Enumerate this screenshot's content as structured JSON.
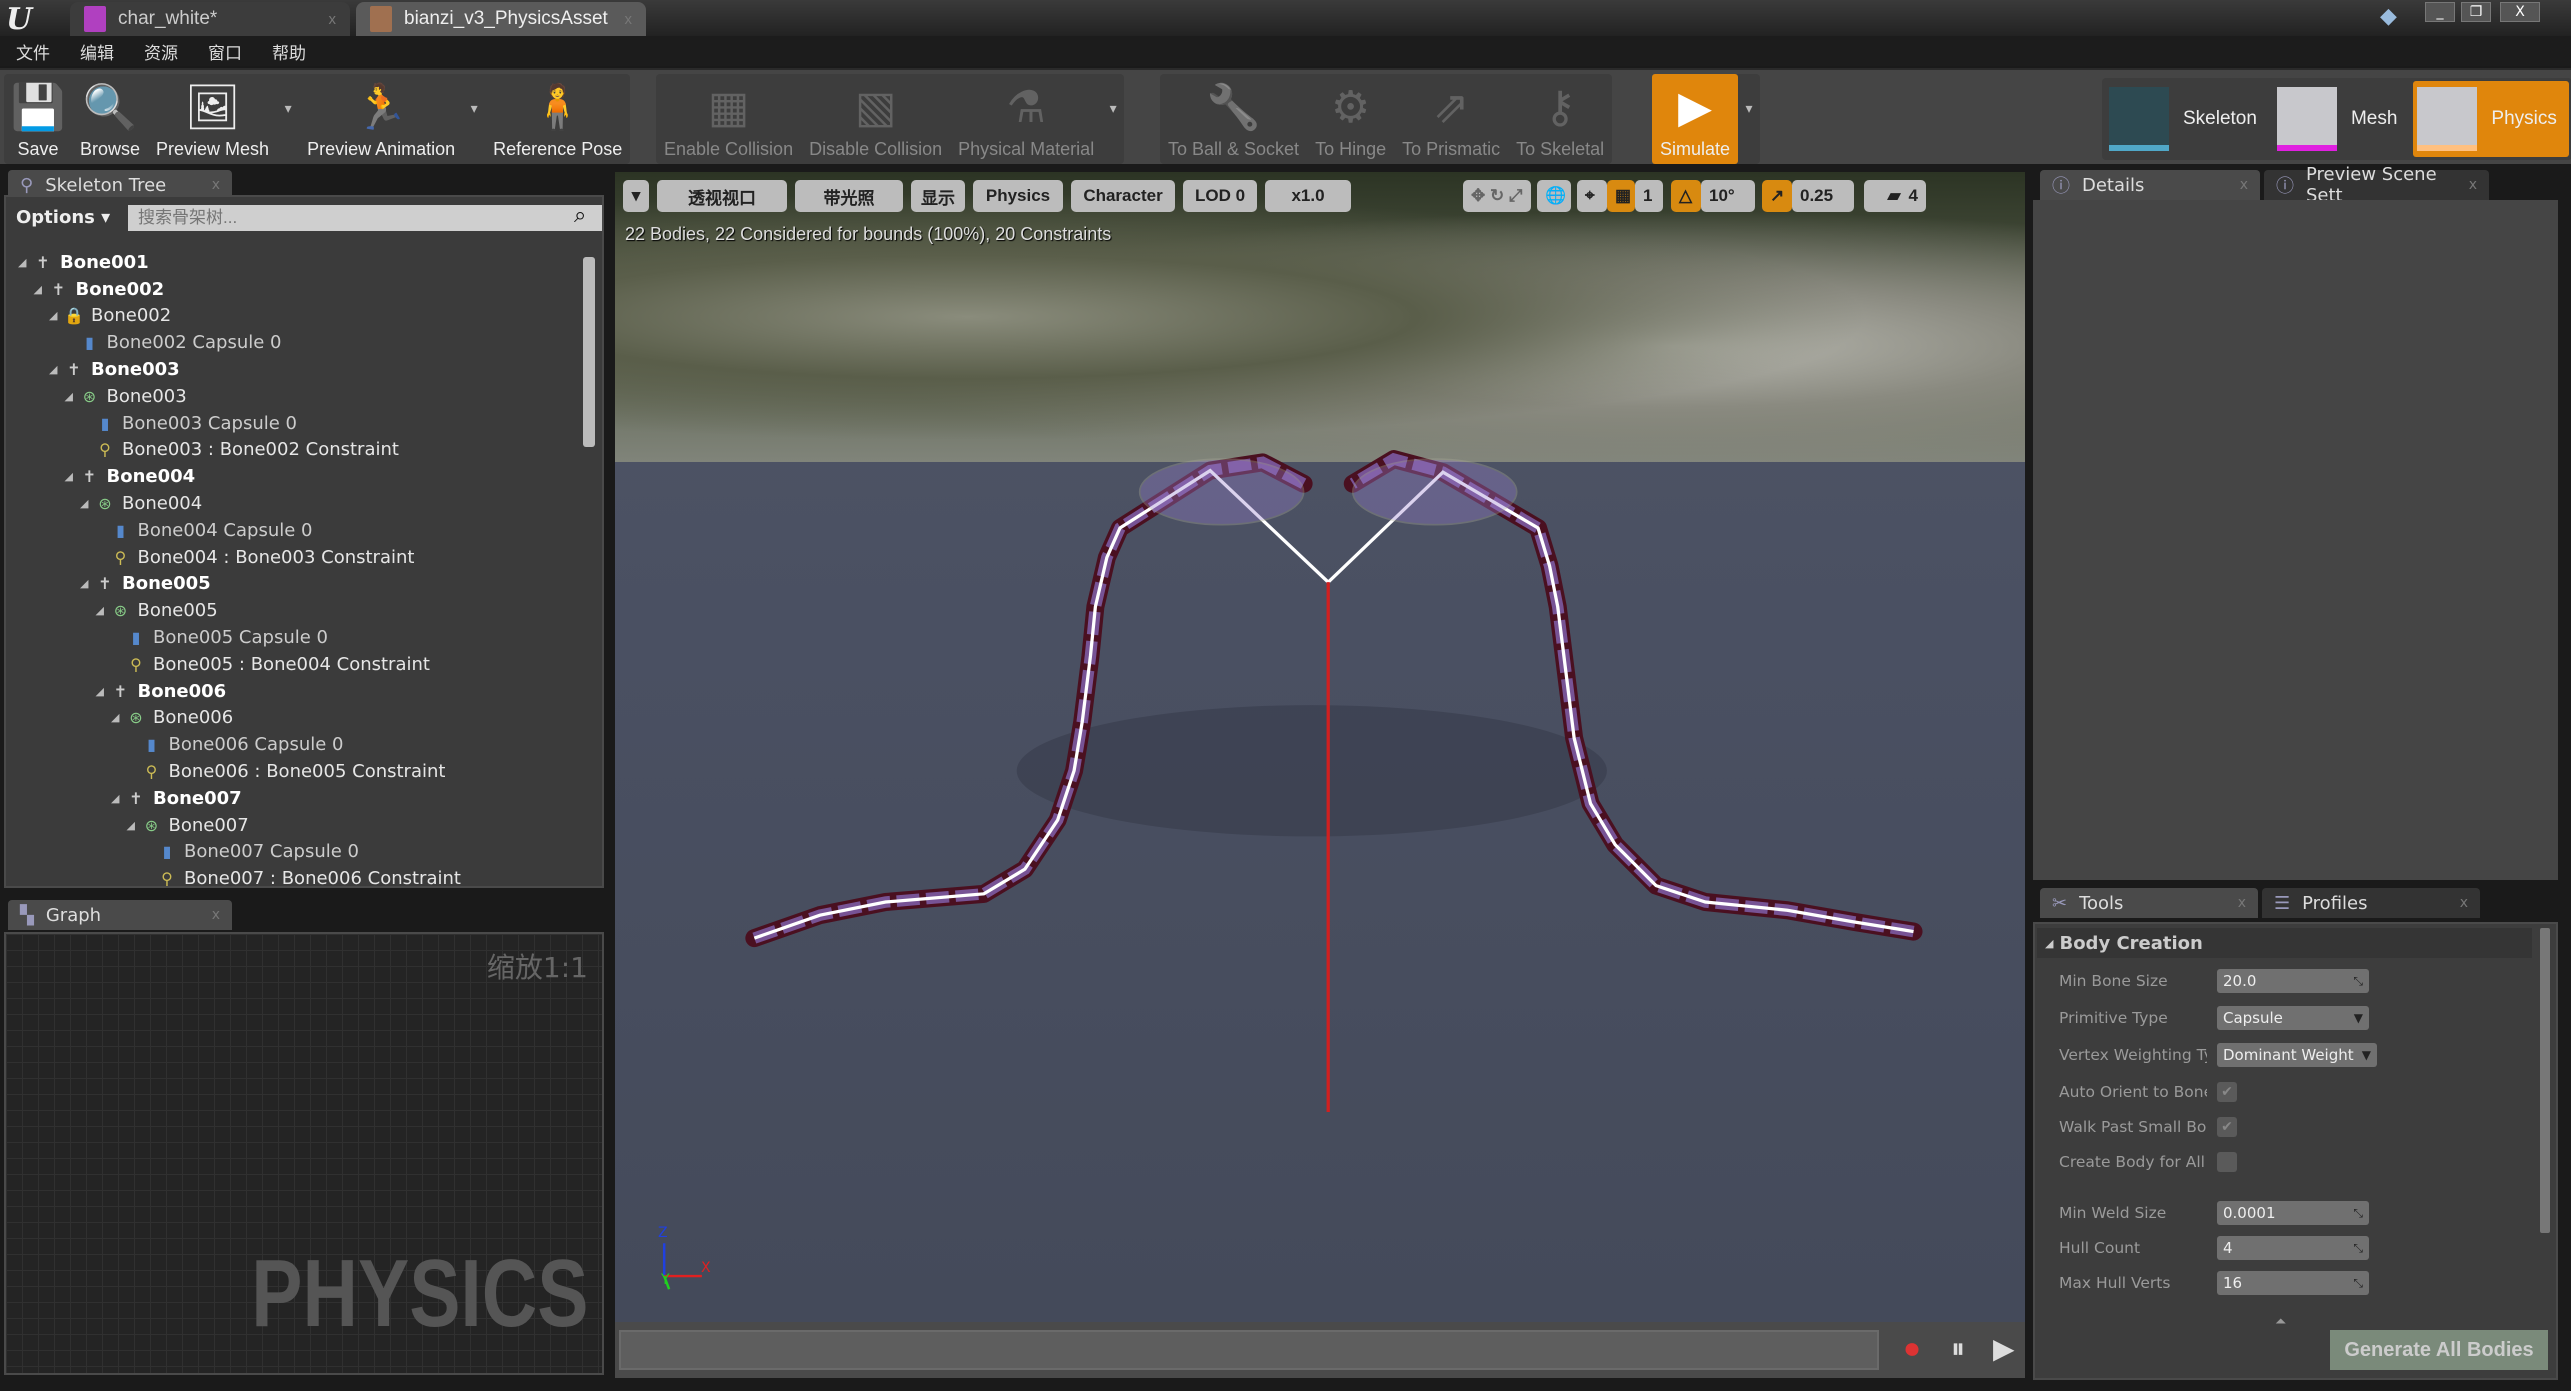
{
  "titlebar": {
    "tabs": [
      {
        "label": "char_white*",
        "color": "#b040c0"
      },
      {
        "label": "bianzi_v3_PhysicsAsset",
        "color": "#a07050"
      }
    ],
    "close": "x",
    "win": [
      "_",
      "❐",
      "X"
    ]
  },
  "menu": [
    "文件",
    "编辑",
    "资源",
    "窗口",
    "帮助"
  ],
  "toolbar": {
    "main": [
      {
        "label": "Save",
        "icon": "💾",
        "name": "save"
      },
      {
        "label": "Browse",
        "icon": "🔍",
        "name": "browse"
      },
      {
        "label": "Preview Mesh",
        "icon": "🖼",
        "name": "preview-mesh",
        "drop": true
      },
      {
        "label": "Preview Animation",
        "icon": "🏃",
        "name": "preview-animation",
        "drop": true
      },
      {
        "label": "Reference Pose",
        "icon": "🧍",
        "name": "reference-pose"
      }
    ],
    "collision": [
      {
        "label": "Enable Collision",
        "icon": "▦",
        "name": "enable-collision"
      },
      {
        "label": "Disable Collision",
        "icon": "▧",
        "name": "disable-collision"
      },
      {
        "label": "Physical Material",
        "icon": "⚗",
        "name": "physical-material",
        "drop": true
      }
    ],
    "constraints": [
      {
        "label": "To Ball & Socket",
        "icon": "🔧",
        "name": "to-ball-socket"
      },
      {
        "label": "To Hinge",
        "icon": "⚙",
        "name": "to-hinge"
      },
      {
        "label": "To Prismatic",
        "icon": "⇗",
        "name": "to-prismatic"
      },
      {
        "label": "To Skeletal",
        "icon": "⚷",
        "name": "to-skeletal"
      }
    ],
    "simulate": {
      "label": "Simulate",
      "icon": "▶"
    },
    "drop": "▾",
    "modes": [
      {
        "label": "Skeleton",
        "bar": "#50a8c8"
      },
      {
        "label": "Mesh",
        "bar": "#e020e0"
      },
      {
        "label": "Physics",
        "bar": "#ffc080"
      }
    ]
  },
  "skeleton_tree": {
    "tab": "Skeleton Tree",
    "options": "Options ▾",
    "search_placeholder": "搜索骨架树...",
    "items": [
      {
        "level": 0,
        "type": "bone",
        "label": "Bone001"
      },
      {
        "level": 1,
        "type": "bone",
        "label": "Bone002"
      },
      {
        "level": 2,
        "type": "body-locked",
        "label": "Bone002"
      },
      {
        "level": 3,
        "type": "capsule",
        "label": "Bone002 Capsule 0"
      },
      {
        "level": 2,
        "type": "bone",
        "label": "Bone003"
      },
      {
        "level": 3,
        "type": "body",
        "label": "Bone003"
      },
      {
        "level": 4,
        "type": "capsule",
        "label": "Bone003 Capsule 0"
      },
      {
        "level": 4,
        "type": "constraint",
        "label": "Bone003 : Bone002 Constraint"
      },
      {
        "level": 3,
        "type": "bone",
        "label": "Bone004"
      },
      {
        "level": 4,
        "type": "body",
        "label": "Bone004"
      },
      {
        "level": 5,
        "type": "capsule",
        "label": "Bone004 Capsule 0"
      },
      {
        "level": 5,
        "type": "constraint",
        "label": "Bone004 : Bone003 Constraint"
      },
      {
        "level": 4,
        "type": "bone",
        "label": "Bone005"
      },
      {
        "level": 5,
        "type": "body",
        "label": "Bone005"
      },
      {
        "level": 6,
        "type": "capsule",
        "label": "Bone005 Capsule 0"
      },
      {
        "level": 6,
        "type": "constraint",
        "label": "Bone005 : Bone004 Constraint"
      },
      {
        "level": 5,
        "type": "bone",
        "label": "Bone006"
      },
      {
        "level": 6,
        "type": "body",
        "label": "Bone006"
      },
      {
        "level": 7,
        "type": "capsule",
        "label": "Bone006 Capsule 0"
      },
      {
        "level": 7,
        "type": "constraint",
        "label": "Bone006 : Bone005 Constraint"
      },
      {
        "level": 6,
        "type": "bone",
        "label": "Bone007"
      },
      {
        "level": 7,
        "type": "body",
        "label": "Bone007"
      },
      {
        "level": 8,
        "type": "capsule",
        "label": "Bone007 Capsule 0"
      },
      {
        "level": 8,
        "type": "constraint",
        "label": "Bone007 : Bone006 Constraint"
      }
    ]
  },
  "graph": {
    "tab": "Graph",
    "zoom": "缩放1:1",
    "watermark": "PHYSICS"
  },
  "viewport": {
    "buttons": [
      "▾",
      "透视视口",
      "带光照",
      "显示",
      "Physics",
      "Character",
      "LOD 0",
      "x1.0"
    ],
    "snap": {
      "grid": "1",
      "angle": "10°",
      "scale": "0.25",
      "camera_speed": "4"
    },
    "status": "22 Bodies, 22 Considered for bounds (100%), 20 Constraints",
    "axis": {
      "z": "Z",
      "x": "X",
      "y": "Y"
    }
  },
  "timeline": {
    "record": "⏺",
    "pause": "⏸",
    "play": "▶"
  },
  "details": {
    "tabs": [
      "Details",
      "Preview Scene Sett"
    ]
  },
  "tools": {
    "tabs": [
      "Tools",
      "Profiles"
    ],
    "section": "Body Creation",
    "props": [
      {
        "label": "Min Bone Size",
        "kind": "num",
        "value": "20.0"
      },
      {
        "label": "Primitive Type",
        "kind": "combo",
        "value": "Capsule"
      },
      {
        "label": "Vertex Weighting Type",
        "kind": "combo",
        "value": "Dominant Weight"
      },
      {
        "label": "Auto Orient to Bone",
        "kind": "check",
        "value": "✔"
      },
      {
        "label": "Walk Past Small Bones",
        "kind": "check",
        "value": "✔"
      },
      {
        "label": "Create Body for All Bones",
        "kind": "check",
        "value": ""
      },
      {
        "label": "Min Weld Size",
        "kind": "num",
        "value": "0.0001"
      },
      {
        "label": "Hull Count",
        "kind": "num",
        "value": "4"
      },
      {
        "label": "Max Hull Verts",
        "kind": "num",
        "value": "16"
      }
    ],
    "generate": "Generate All Bodies"
  }
}
